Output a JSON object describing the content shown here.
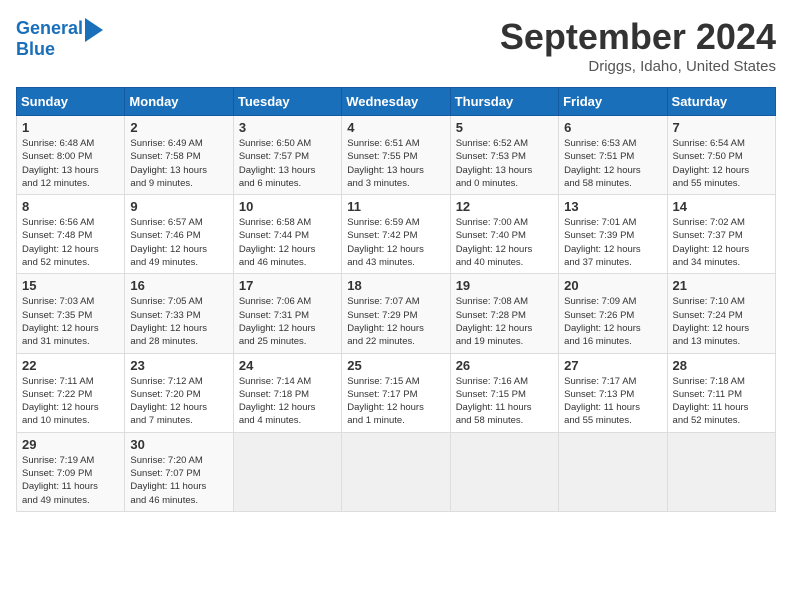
{
  "header": {
    "logo_line1": "General",
    "logo_line2": "Blue",
    "month": "September 2024",
    "location": "Driggs, Idaho, United States"
  },
  "days_of_week": [
    "Sunday",
    "Monday",
    "Tuesday",
    "Wednesday",
    "Thursday",
    "Friday",
    "Saturday"
  ],
  "weeks": [
    [
      {
        "day": "1",
        "info": "Sunrise: 6:48 AM\nSunset: 8:00 PM\nDaylight: 13 hours\nand 12 minutes."
      },
      {
        "day": "2",
        "info": "Sunrise: 6:49 AM\nSunset: 7:58 PM\nDaylight: 13 hours\nand 9 minutes."
      },
      {
        "day": "3",
        "info": "Sunrise: 6:50 AM\nSunset: 7:57 PM\nDaylight: 13 hours\nand 6 minutes."
      },
      {
        "day": "4",
        "info": "Sunrise: 6:51 AM\nSunset: 7:55 PM\nDaylight: 13 hours\nand 3 minutes."
      },
      {
        "day": "5",
        "info": "Sunrise: 6:52 AM\nSunset: 7:53 PM\nDaylight: 13 hours\nand 0 minutes."
      },
      {
        "day": "6",
        "info": "Sunrise: 6:53 AM\nSunset: 7:51 PM\nDaylight: 12 hours\nand 58 minutes."
      },
      {
        "day": "7",
        "info": "Sunrise: 6:54 AM\nSunset: 7:50 PM\nDaylight: 12 hours\nand 55 minutes."
      }
    ],
    [
      {
        "day": "8",
        "info": "Sunrise: 6:56 AM\nSunset: 7:48 PM\nDaylight: 12 hours\nand 52 minutes."
      },
      {
        "day": "9",
        "info": "Sunrise: 6:57 AM\nSunset: 7:46 PM\nDaylight: 12 hours\nand 49 minutes."
      },
      {
        "day": "10",
        "info": "Sunrise: 6:58 AM\nSunset: 7:44 PM\nDaylight: 12 hours\nand 46 minutes."
      },
      {
        "day": "11",
        "info": "Sunrise: 6:59 AM\nSunset: 7:42 PM\nDaylight: 12 hours\nand 43 minutes."
      },
      {
        "day": "12",
        "info": "Sunrise: 7:00 AM\nSunset: 7:40 PM\nDaylight: 12 hours\nand 40 minutes."
      },
      {
        "day": "13",
        "info": "Sunrise: 7:01 AM\nSunset: 7:39 PM\nDaylight: 12 hours\nand 37 minutes."
      },
      {
        "day": "14",
        "info": "Sunrise: 7:02 AM\nSunset: 7:37 PM\nDaylight: 12 hours\nand 34 minutes."
      }
    ],
    [
      {
        "day": "15",
        "info": "Sunrise: 7:03 AM\nSunset: 7:35 PM\nDaylight: 12 hours\nand 31 minutes."
      },
      {
        "day": "16",
        "info": "Sunrise: 7:05 AM\nSunset: 7:33 PM\nDaylight: 12 hours\nand 28 minutes."
      },
      {
        "day": "17",
        "info": "Sunrise: 7:06 AM\nSunset: 7:31 PM\nDaylight: 12 hours\nand 25 minutes."
      },
      {
        "day": "18",
        "info": "Sunrise: 7:07 AM\nSunset: 7:29 PM\nDaylight: 12 hours\nand 22 minutes."
      },
      {
        "day": "19",
        "info": "Sunrise: 7:08 AM\nSunset: 7:28 PM\nDaylight: 12 hours\nand 19 minutes."
      },
      {
        "day": "20",
        "info": "Sunrise: 7:09 AM\nSunset: 7:26 PM\nDaylight: 12 hours\nand 16 minutes."
      },
      {
        "day": "21",
        "info": "Sunrise: 7:10 AM\nSunset: 7:24 PM\nDaylight: 12 hours\nand 13 minutes."
      }
    ],
    [
      {
        "day": "22",
        "info": "Sunrise: 7:11 AM\nSunset: 7:22 PM\nDaylight: 12 hours\nand 10 minutes."
      },
      {
        "day": "23",
        "info": "Sunrise: 7:12 AM\nSunset: 7:20 PM\nDaylight: 12 hours\nand 7 minutes."
      },
      {
        "day": "24",
        "info": "Sunrise: 7:14 AM\nSunset: 7:18 PM\nDaylight: 12 hours\nand 4 minutes."
      },
      {
        "day": "25",
        "info": "Sunrise: 7:15 AM\nSunset: 7:17 PM\nDaylight: 12 hours\nand 1 minute."
      },
      {
        "day": "26",
        "info": "Sunrise: 7:16 AM\nSunset: 7:15 PM\nDaylight: 11 hours\nand 58 minutes."
      },
      {
        "day": "27",
        "info": "Sunrise: 7:17 AM\nSunset: 7:13 PM\nDaylight: 11 hours\nand 55 minutes."
      },
      {
        "day": "28",
        "info": "Sunrise: 7:18 AM\nSunset: 7:11 PM\nDaylight: 11 hours\nand 52 minutes."
      }
    ],
    [
      {
        "day": "29",
        "info": "Sunrise: 7:19 AM\nSunset: 7:09 PM\nDaylight: 11 hours\nand 49 minutes."
      },
      {
        "day": "30",
        "info": "Sunrise: 7:20 AM\nSunset: 7:07 PM\nDaylight: 11 hours\nand 46 minutes."
      },
      {
        "day": "",
        "info": ""
      },
      {
        "day": "",
        "info": ""
      },
      {
        "day": "",
        "info": ""
      },
      {
        "day": "",
        "info": ""
      },
      {
        "day": "",
        "info": ""
      }
    ]
  ]
}
